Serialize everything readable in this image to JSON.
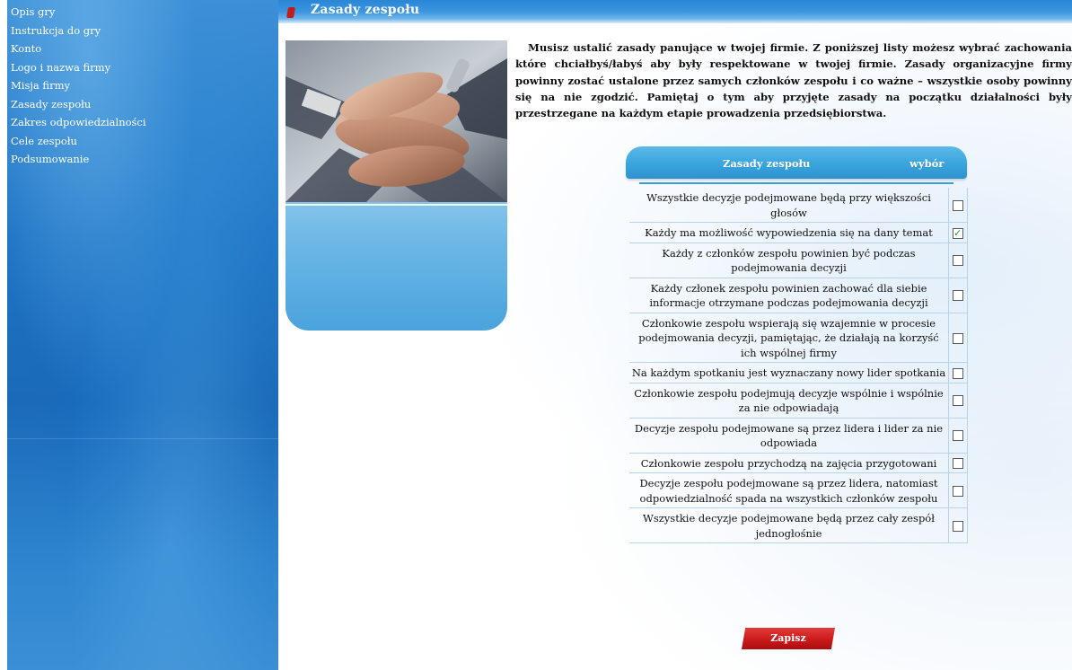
{
  "sidebar": {
    "items": [
      {
        "label": "Opis gry"
      },
      {
        "label": "Instrukcja do gry"
      },
      {
        "label": "Konto"
      },
      {
        "label": "Logo i nazwa firmy"
      },
      {
        "label": "Misja firmy"
      },
      {
        "label": "Zasady zespołu"
      },
      {
        "label": "Zakres odpowiedzialności"
      },
      {
        "label": "Cele zespołu"
      },
      {
        "label": "Podsumowanie"
      }
    ]
  },
  "header": {
    "title": "Zasady zespołu"
  },
  "intro": {
    "text": "Musisz ustalić zasady panujące w twojej firmie. Z poniższej listy możesz wybrać zachowania które chciałbyś/łabyś aby były respektowane w twojej firmie. Zasady organizacyjne firmy powinny zostać ustalone przez samych członków zespołu i co ważne – wszystkie osoby powinny się na nie zgodzić. Pamiętaj o tym aby przyjęte zasady na początku działalności były przestrzegane na każdym etapie prowadzenia przedsiębiorstwa."
  },
  "rules_table": {
    "header_rules": "Zasady zespołu",
    "header_choice": "wybór",
    "rows": [
      {
        "label": "Wszystkie decyzje podejmowane będą przy większości głosów",
        "checked": false
      },
      {
        "label": "Każdy ma możliwość wypowiedzenia się na dany temat",
        "checked": true
      },
      {
        "label": "Każdy z członków zespołu powinien być podczas podejmowania decyzji",
        "checked": false
      },
      {
        "label": "Każdy członek zespołu powinien zachować dla siebie informacje otrzymane podczas podejmowania decyzji",
        "checked": false
      },
      {
        "label": "Członkowie zespołu wspierają się wzajemnie w procesie podejmowania decyzji, pamiętając, że działają na korzyść ich wspólnej firmy",
        "checked": false
      },
      {
        "label": "Na każdym spotkaniu jest wyznaczany nowy lider spotkania",
        "checked": false
      },
      {
        "label": "Członkowie zespołu podejmują decyzje wspólnie i wspólnie za nie odpowiadają",
        "checked": false
      },
      {
        "label": "Decyzje zespołu podejmowane są przez lidera i lider za nie odpowiada",
        "checked": false
      },
      {
        "label": "Członkowie zespołu przychodzą na zajęcia przygotowani",
        "checked": false
      },
      {
        "label": "Decyzje zespołu podejmowane są przez lidera, natomiast odpowiedzialność spada na wszystkich członków zespołu",
        "checked": false
      },
      {
        "label": "Wszystkie decyzje podejmowane będą przez cały zespół jednogłośnie",
        "checked": false
      }
    ]
  },
  "actions": {
    "save_label": "Zapisz"
  },
  "colors": {
    "sidebar": "#1e74c4",
    "title_bar": "#2a86d6",
    "table_header": "#3aa4dd",
    "save_button": "#c81818"
  }
}
